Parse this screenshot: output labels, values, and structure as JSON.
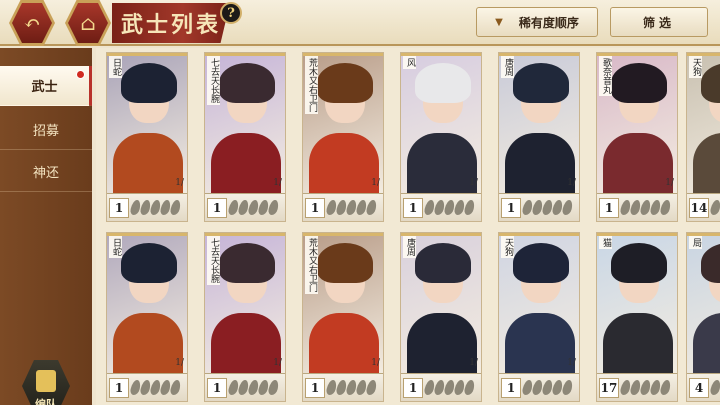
{
  "header": {
    "title": "武士列表",
    "help": "?",
    "back_icon": "back-arrow-icon",
    "home_icon": "home-icon",
    "sort_label": "稀有度顺序",
    "filter_label": "筛选"
  },
  "sidebar": {
    "tabs": [
      {
        "label": "武士",
        "active": true
      },
      {
        "label": "招募",
        "active": false
      },
      {
        "label": "神还",
        "active": false
      }
    ],
    "team_label": "编队"
  },
  "cards": [
    {
      "name": "日蛇",
      "level": "1",
      "ratio": "1/",
      "bg": "#a9a3b8",
      "hair": "#1c2233",
      "body": "#b24a1f"
    },
    {
      "name": "七去天长腕",
      "level": "1",
      "ratio": "1/",
      "bg": "#c5b4d8",
      "hair": "#3a2a30",
      "body": "#8a1e22"
    },
    {
      "name": "荒木又右卫门",
      "level": "1",
      "ratio": "1/",
      "bg": "#b89c88",
      "hair": "#6a3a1a",
      "body": "#c23b22"
    },
    {
      "name": "风",
      "level": "1",
      "ratio": "1/",
      "bg": "#d6cce0",
      "hair": "#e8e8ea",
      "body": "#2a2c3a"
    },
    {
      "name": "唐周",
      "level": "1",
      "ratio": "1/",
      "bg": "#c8cad8",
      "hair": "#20283a",
      "body": "#1e2230"
    },
    {
      "name": "歌奈音丸",
      "level": "1",
      "ratio": "1/",
      "bg": "#d8b8c8",
      "hair": "#221a22",
      "body": "#7a2a2e"
    },
    {
      "name": "天狗",
      "level": "14",
      "ratio": "",
      "bg": "#c8c0b0",
      "hair": "#4a3a2a",
      "body": "#5a4a3a"
    },
    {
      "name": "日蛇",
      "level": "1",
      "ratio": "1/",
      "bg": "#b0a8bc",
      "hair": "#1c2233",
      "body": "#b24a1f"
    },
    {
      "name": "七去天长腕",
      "level": "1",
      "ratio": "1/",
      "bg": "#c5b4d8",
      "hair": "#3a2a30",
      "body": "#8a1e22"
    },
    {
      "name": "荒木又右卫门",
      "level": "1",
      "ratio": "1/",
      "bg": "#b89c88",
      "hair": "#6a3a1a",
      "body": "#c23b22"
    },
    {
      "name": "唐周",
      "level": "1",
      "ratio": "1/",
      "bg": "#d8d0dc",
      "hair": "#2a2a38",
      "body": "#1e2230"
    },
    {
      "name": "天狗",
      "level": "1",
      "ratio": "1/",
      "bg": "#cfd4e2",
      "hair": "#1e2438",
      "body": "#2a3450"
    },
    {
      "name": "猫",
      "level": "17",
      "ratio": "",
      "bg": "#c8d6e6",
      "hair": "#1e1e26",
      "body": "#2a2a30"
    },
    {
      "name": "局",
      "level": "4",
      "ratio": "",
      "bg": "#c8d4e2",
      "hair": "#3a2a2a",
      "body": "#3a3a4a"
    }
  ]
}
